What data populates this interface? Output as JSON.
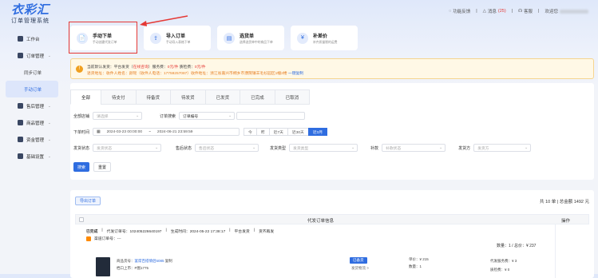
{
  "brand": {
    "logo": "衣彩汇",
    "subtitle": "订单管理系统"
  },
  "topbar": {
    "feedback": "功能反馈",
    "message": "消息",
    "message_count": "(25)",
    "service": "客服",
    "welcome": "欢迎您"
  },
  "sidebar": [
    {
      "label": "工作台",
      "name": "sidebar-item-workbench",
      "icon": "home-icon"
    },
    {
      "label": "订单管理",
      "name": "sidebar-item-orders",
      "icon": "order-icon",
      "chev": "⌄"
    },
    {
      "label": "同步订单",
      "name": "sidebar-item-sync-orders",
      "sub": true
    },
    {
      "label": "手动订单",
      "name": "sidebar-item-manual-orders",
      "sub": true,
      "active": true
    },
    {
      "label": "售后管理",
      "name": "sidebar-item-after-sales",
      "icon": "heart-icon",
      "chev": "⌄"
    },
    {
      "label": "商品管理",
      "name": "sidebar-item-goods",
      "icon": "box-icon",
      "chev": "⌄"
    },
    {
      "label": "资金管理",
      "name": "sidebar-item-funds",
      "icon": "shield-icon",
      "chev": "⌄"
    },
    {
      "label": "基础设置",
      "name": "sidebar-item-settings",
      "icon": "gear-icon",
      "chev": "⌄"
    }
  ],
  "cards": [
    {
      "title": "手动下单",
      "sub": "手动创建代发订单",
      "icon": "📄"
    },
    {
      "title": "导入订单",
      "sub": "手动导入表格下单",
      "icon": "⇪"
    },
    {
      "title": "选货单",
      "sub": "选择选货单中的商品下单",
      "icon": "▤"
    },
    {
      "title": "补差价",
      "sub": "补齐质量税的运费",
      "icon": "¥"
    }
  ],
  "notice": {
    "line1_a": "当前默认发货：平台发货（",
    "line1_b": "在线咨询",
    "line1_c": "）服务费：",
    "line1_d": "0元/件",
    "line1_e": "  质检费：",
    "line1_f": "0元/件",
    "line2": "退货地址：收件人姓名：颜瑶（收件人电话：17759257087）收件地址：浙江省嘉兴市桐乡市濮院镇羊毛衫园区1幢2楼",
    "line2_link": "一键复制"
  },
  "tabs": [
    "全部",
    "待支付",
    "待备货",
    "待发货",
    "已发货",
    "已完成",
    "已取消"
  ],
  "filters": {
    "shop_label": "全部店铺",
    "shop_ph": "请选择",
    "search_label": "订单搜索",
    "search_type": "订单编号",
    "time_label": "下单时间",
    "date_from": "2024-03-23 00:00:00",
    "date_sep": "~",
    "date_to": "2024-06-21 23:59:59",
    "ranges": [
      "今",
      "昨",
      "近7天",
      "近30天",
      "近3月"
    ],
    "status_fields": [
      {
        "label": "发货状态",
        "ph": "发货状态"
      },
      {
        "label": "售后状态",
        "ph": "售后状态"
      },
      {
        "label": "发货类型",
        "ph": "发货类型"
      },
      {
        "label": "补款",
        "ph": "补款状态"
      },
      {
        "label": "发货方",
        "ph": "发货方"
      }
    ],
    "search_btn": "搜索",
    "reset_btn": "重置"
  },
  "list": {
    "import": "导出订单",
    "total": "共 10 单 | 总金额 1492 元",
    "col_info": "代发订单信息",
    "col_op": "操作",
    "order_status": "已完成",
    "order_no": "代发订单号：102405226640197",
    "order_time": "生成时间：2024-05-22 17:38:17",
    "order_ship": "平台发货",
    "order_pay": "货齐再发",
    "channel": "渠道订单号：---",
    "qty": "数量：1 / 总价：¥ 237",
    "goods_code_label": "商品货号：",
    "goods_code": "宴席百搭情侣5085",
    "goods_tag": "复制",
    "goods_loc_label": "档口上市：",
    "goods_loc": "P图1775",
    "status_tag": "已备货",
    "ship_info": "发货物流 >",
    "unit_price": "单价：¥ 215",
    "count": "数量：1",
    "svc_fee": "代发服务费：¥ 3",
    "qc_fee": "质检费：¥ 0"
  }
}
